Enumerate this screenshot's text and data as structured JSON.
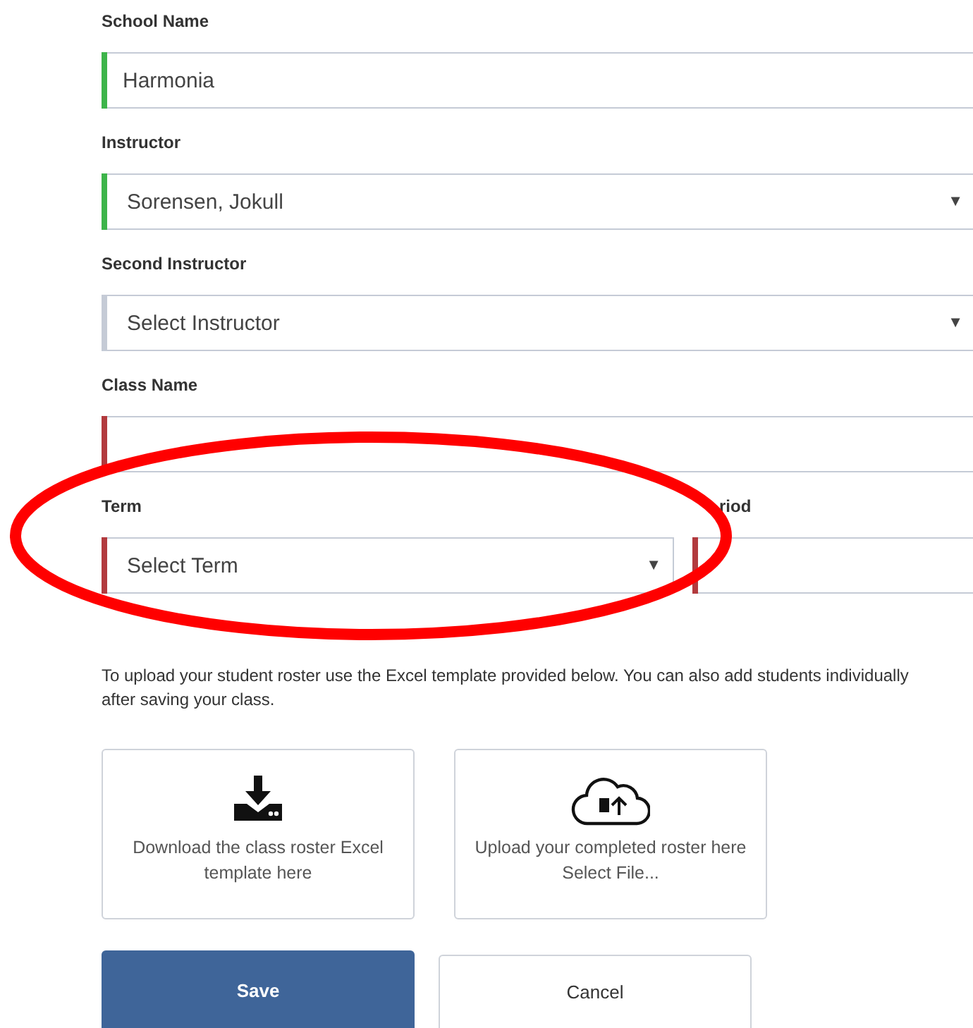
{
  "fields": [
    {
      "label": "School Name",
      "kind": "text",
      "value": "Harmonia",
      "color": "#3db44a"
    },
    {
      "label": "Instructor",
      "kind": "select",
      "value": "Sorensen, Jokull",
      "color": "#3db44a",
      "arrow": "▼"
    },
    {
      "label": "Second Instructor",
      "kind": "select",
      "value": "Select Instructor",
      "arrow": "▼"
    },
    {
      "label": "Class Name",
      "kind": "text",
      "color": "#b23a3e"
    }
  ],
  "row": [
    {
      "label": "Term",
      "kind": "select",
      "value": "Select Term",
      "color": "#b23a3e",
      "arrow": "▼"
    },
    {
      "label": "riod",
      "kind": "text",
      "color": "#b23a3e"
    }
  ],
  "instructions": "To upload your student roster use the Excel template provided below. You can also add students individually after saving your class.",
  "cards": [
    {
      "kind": "download",
      "text": "Download the class roster Excel template here"
    },
    {
      "kind": "upload",
      "text": "Upload your completed roster here",
      "link": "Select File..."
    }
  ],
  "buttons": [
    {
      "label": "Save",
      "kind": "primary"
    },
    {
      "label": "Cancel",
      "kind": "secondary"
    }
  ],
  "annotation": {
    "kind": "ellipse",
    "color": "#ff0000"
  }
}
